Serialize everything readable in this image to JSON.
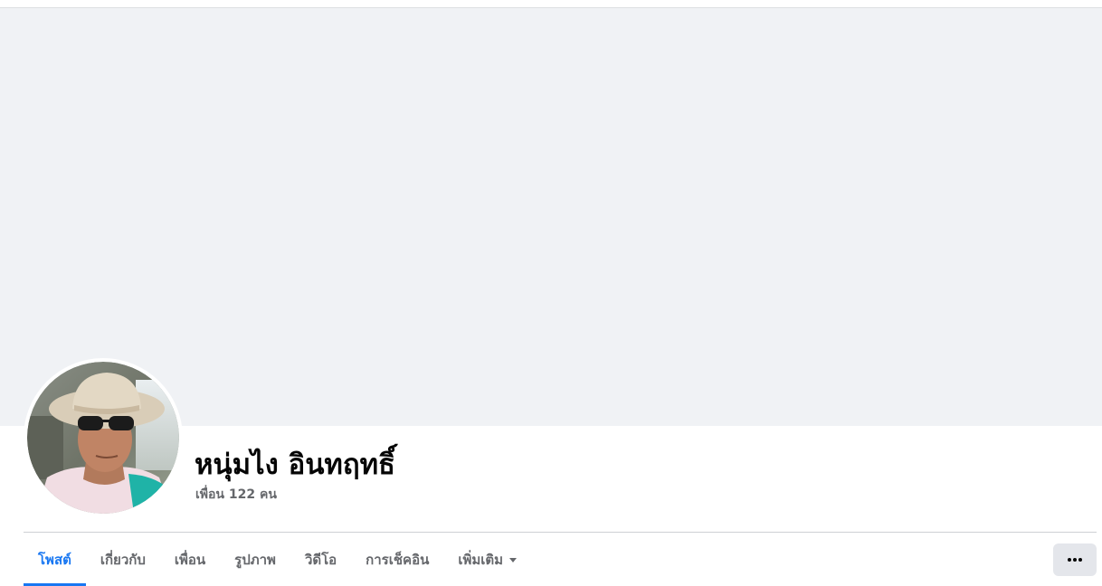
{
  "profile": {
    "name": "หนุ่มไง อินทฤทธิ์",
    "friends_text": "เพื่อน 122 คน",
    "avatar_icon": "profile-photo"
  },
  "tabs": [
    {
      "label": "โพสต์",
      "active": true
    },
    {
      "label": "เกี่ยวกับ",
      "active": false
    },
    {
      "label": "เพื่อน",
      "active": false
    },
    {
      "label": "รูปภาพ",
      "active": false
    },
    {
      "label": "วิดีโอ",
      "active": false
    },
    {
      "label": "การเช็คอิน",
      "active": false
    },
    {
      "label": "เพิ่มเติม",
      "active": false
    }
  ],
  "more_button": {
    "icon": "ellipsis-icon"
  },
  "colors": {
    "accent": "#1877f2",
    "cover": "#f0f2f5",
    "secondary_text": "#65676b"
  }
}
